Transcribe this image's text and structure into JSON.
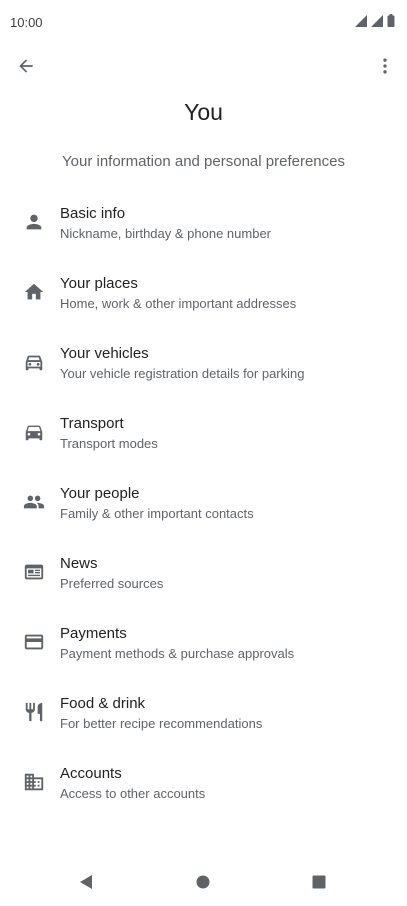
{
  "status_bar": {
    "time": "10:00"
  },
  "page": {
    "title": "You",
    "subtitle": "Your information and personal preferences"
  },
  "items": [
    {
      "title": "Basic info",
      "subtitle": "Nickname, birthday & phone number",
      "icon": "person-icon"
    },
    {
      "title": "Your places",
      "subtitle": "Home, work & other important addresses",
      "icon": "home-icon"
    },
    {
      "title": "Your vehicles",
      "subtitle": "Your vehicle registration details for parking",
      "icon": "car-outline-icon"
    },
    {
      "title": "Transport",
      "subtitle": "Transport modes",
      "icon": "car-icon"
    },
    {
      "title": "Your people",
      "subtitle": "Family & other important contacts",
      "icon": "people-icon"
    },
    {
      "title": "News",
      "subtitle": "Preferred sources",
      "icon": "news-icon"
    },
    {
      "title": "Payments",
      "subtitle": "Payment methods & purchase approvals",
      "icon": "credit-card-icon"
    },
    {
      "title": "Food & drink",
      "subtitle": "For better recipe recommendations",
      "icon": "restaurant-icon"
    },
    {
      "title": "Accounts",
      "subtitle": "Access to other accounts",
      "icon": "building-icon"
    }
  ],
  "colors": {
    "icon": "#5f6368",
    "text_primary": "#202124",
    "text_secondary": "#5f6368"
  }
}
